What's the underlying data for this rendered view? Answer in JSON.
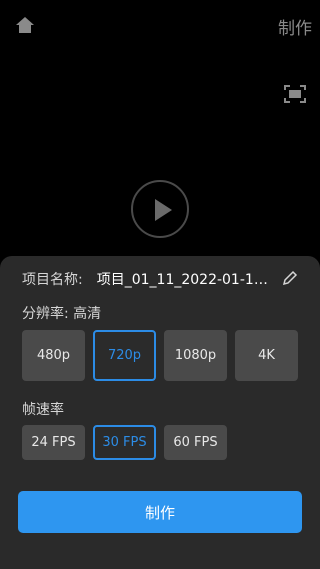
{
  "header": {
    "make_label": "制作"
  },
  "project": {
    "name_label": "项目名称:",
    "name_value": "项目_01_11_2022-01-11-1..."
  },
  "resolution": {
    "label": "分辨率: 高清",
    "options": [
      "480p",
      "720p",
      "1080p",
      "4K"
    ],
    "selected": "720p"
  },
  "frame_rate": {
    "label": "帧速率",
    "options": [
      "24 FPS",
      "30 FPS",
      "60 FPS"
    ],
    "selected": "30 FPS"
  },
  "action": {
    "make_label": "制作"
  },
  "icons": {
    "home": "home-icon",
    "fullscreen": "fullscreen-icon",
    "play": "play-icon",
    "edit": "pencil-icon"
  },
  "colors": {
    "accent": "#2e96f0",
    "panel": "#2a2a2a",
    "option": "#4a4a4a"
  }
}
